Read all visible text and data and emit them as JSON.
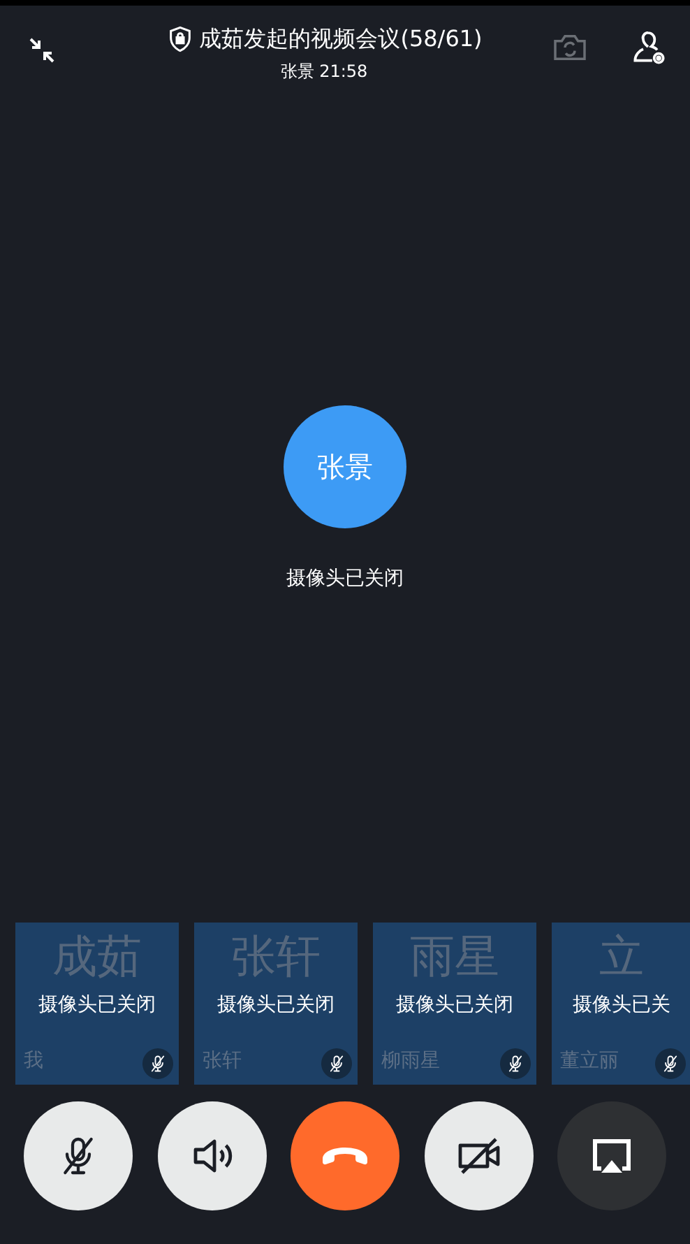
{
  "header": {
    "title": "成茹发起的视频会议(58/61)",
    "subtitle": "张景 21:58"
  },
  "speaker": {
    "avatar": "张景",
    "status": "摄像头已关闭"
  },
  "tiles": [
    {
      "watermark": "成茹",
      "status": "摄像头已关闭",
      "name": "我",
      "muted": true
    },
    {
      "watermark": "张轩",
      "status": "摄像头已关闭",
      "name": "张轩",
      "muted": true
    },
    {
      "watermark": "雨星",
      "status": "摄像头已关闭",
      "name": "柳雨星",
      "muted": true
    },
    {
      "watermark": "立",
      "status": "摄像头已关",
      "name": "董立丽",
      "muted": true
    }
  ],
  "controls": [
    {
      "kind": "mic",
      "on": false
    },
    {
      "kind": "speaker",
      "on": true
    },
    {
      "kind": "hangup"
    },
    {
      "kind": "camera",
      "on": false
    },
    {
      "kind": "share"
    }
  ]
}
